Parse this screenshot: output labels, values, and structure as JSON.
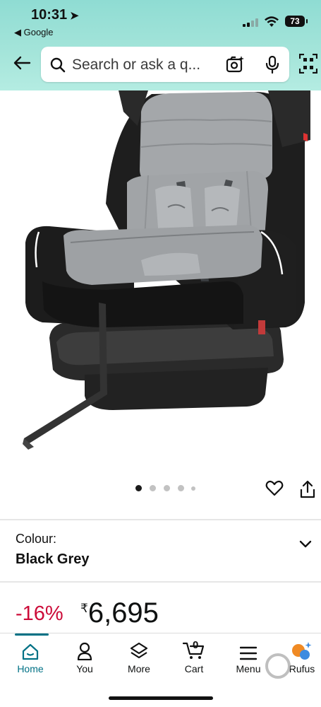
{
  "status_bar": {
    "time": "10:31",
    "back_app": "Google",
    "battery": "73"
  },
  "search": {
    "placeholder": "Search or ask a q..."
  },
  "gallery": {
    "dot_count": 5,
    "active_index": 0
  },
  "variant": {
    "label": "Colour:",
    "value": "Black Grey"
  },
  "pricing": {
    "discount": "-16%",
    "currency": "₹",
    "amount": "6,695"
  },
  "bottom_nav": {
    "items": [
      {
        "label": "Home",
        "icon": "home-icon"
      },
      {
        "label": "You",
        "icon": "person-icon"
      },
      {
        "label": "More",
        "icon": "layers-icon"
      },
      {
        "label": "Cart",
        "icon": "cart-icon",
        "badge": "0"
      },
      {
        "label": "Menu",
        "icon": "menu-icon"
      },
      {
        "label": "Rufus",
        "icon": "rufus-icon"
      }
    ]
  },
  "colors": {
    "header_gradient": "#a5e5da",
    "accent": "#007185",
    "discount": "#cc0c39",
    "link": "#007185"
  }
}
